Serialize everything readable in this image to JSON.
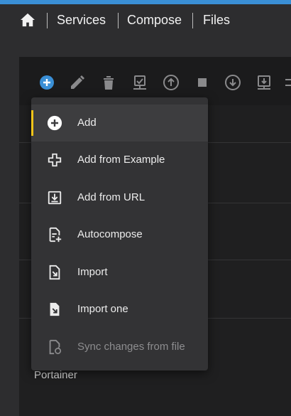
{
  "nav": {
    "links": [
      "Services",
      "Compose",
      "Files"
    ]
  },
  "colors": {
    "accent": "#3a8fd6",
    "selected_indicator": "#f0c419",
    "menu_bg": "#333335"
  },
  "toolbar": {
    "icons": [
      "add-circle-icon",
      "edit-icon",
      "delete-icon",
      "deploy-icon",
      "upload-icon",
      "stop-icon",
      "download-icon",
      "save-download-icon",
      "more-icon"
    ]
  },
  "background": {
    "row_label": "Portainer"
  },
  "menu": {
    "items": [
      {
        "label": "Add",
        "icon": "add-circle-icon",
        "selected": true,
        "disabled": false
      },
      {
        "label": "Add from Example",
        "icon": "add-cross-icon",
        "selected": false,
        "disabled": false
      },
      {
        "label": "Add from URL",
        "icon": "download-box-icon",
        "selected": false,
        "disabled": false
      },
      {
        "label": "Autocompose",
        "icon": "file-plus-icon",
        "selected": false,
        "disabled": false
      },
      {
        "label": "Import",
        "icon": "file-import-icon",
        "selected": false,
        "disabled": false
      },
      {
        "label": "Import one",
        "icon": "file-import-one-icon",
        "selected": false,
        "disabled": false
      },
      {
        "label": "Sync changes from file",
        "icon": "file-sync-icon",
        "selected": false,
        "disabled": true
      }
    ]
  }
}
